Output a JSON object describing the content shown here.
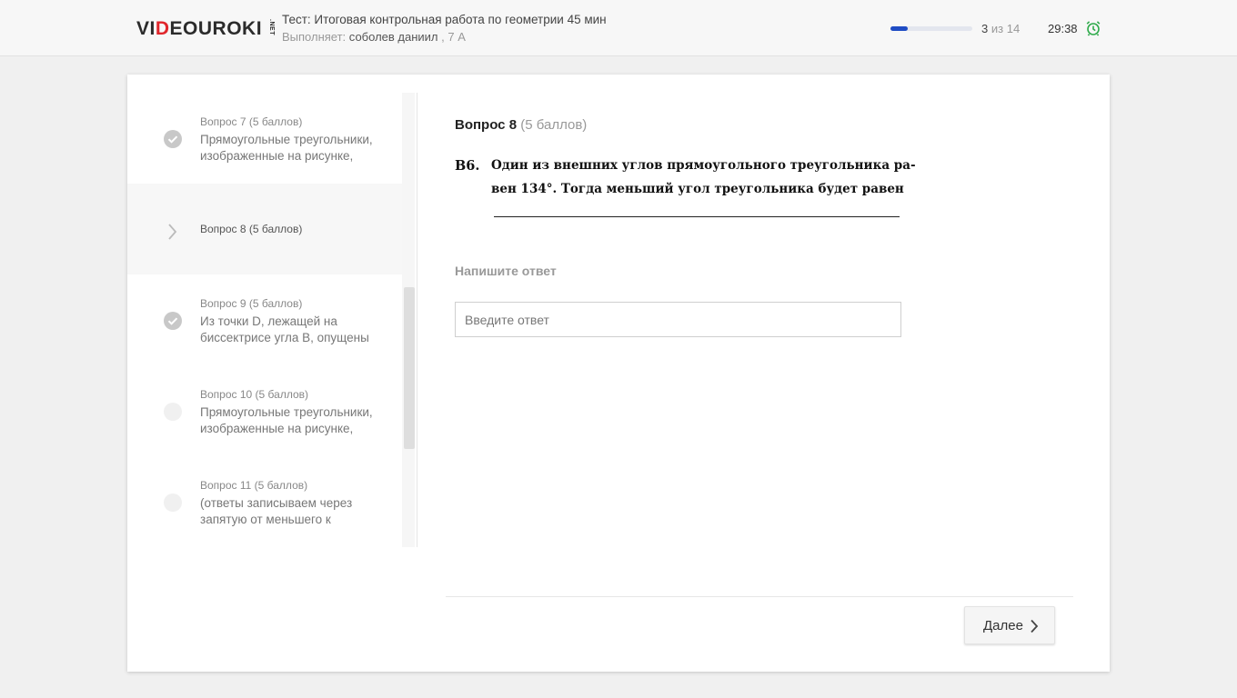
{
  "header": {
    "logo": {
      "part1": "VI",
      "part2": "D",
      "part3": "EOUROKI",
      "suffix": ".NET"
    },
    "test_title": "Тест: Итоговая контрольная работа по геометрии 45 мин",
    "performer_label": "Выполняет:",
    "performer_name": "соболев даниил",
    "performer_class": ", 7 А",
    "progress": {
      "current": "3",
      "separator": "из",
      "total": "14",
      "fraction": 0.214
    },
    "timer": "29:38",
    "accent_color": "#1f4cc4",
    "alarm_color": "#2eaa4a"
  },
  "sidebar": {
    "items": [
      {
        "head": "Вопрос 7 (5 баллов)",
        "text": "Прямоугольные треугольники, изображенные на рисунке,",
        "status": "done"
      },
      {
        "head": "Вопрос 8 (5 баллов)",
        "text": "",
        "status": "current"
      },
      {
        "head": "Вопрос 9 (5 баллов)",
        "text": "Из точки D, лежащей на биссектрисе угла B, опущены",
        "status": "done"
      },
      {
        "head": "Вопрос 10 (5 баллов)",
        "text": "Прямоугольные треугольники, изображенные на рисунке,",
        "status": "empty"
      },
      {
        "head": "Вопрос 11 (5 баллов)",
        "text": "(ответы записываем через запятую от меньшего к",
        "status": "empty"
      }
    ]
  },
  "question": {
    "label": "Вопрос 8",
    "points": "(5 баллов)",
    "problem_number": "B6.",
    "problem_line1": "Один из внешних углов прямоугольного треугольника ра-",
    "problem_line2": "вен 134°. Тогда меньший угол треугольника будет равен",
    "answer_label": "Напишите ответ",
    "answer_placeholder": "Введите ответ",
    "answer_value": ""
  },
  "footer": {
    "next_label": "Далее"
  }
}
